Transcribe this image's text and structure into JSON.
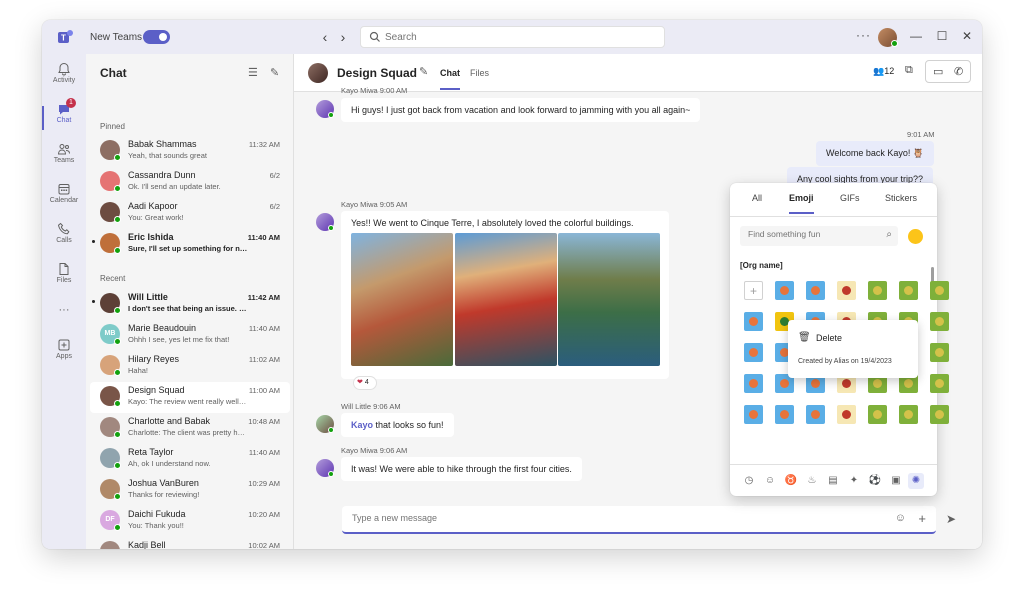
{
  "titlebar": {
    "new_teams_label": "New Teams",
    "search_placeholder": "Search",
    "back_icon": "‹",
    "forward_icon": "›",
    "more_icon": "···",
    "minimize_icon": "—",
    "maximize_icon": "☐",
    "close_icon": "✕"
  },
  "rail": {
    "items": [
      {
        "label": "Activity"
      },
      {
        "label": "Chat",
        "badge": "1"
      },
      {
        "label": "Teams"
      },
      {
        "label": "Calendar"
      },
      {
        "label": "Calls"
      },
      {
        "label": "Files"
      },
      {
        "label": "···"
      },
      {
        "label": "Apps"
      }
    ]
  },
  "chatlist": {
    "title": "Chat",
    "pinned_label": "Pinned",
    "recent_label": "Recent",
    "pinned": [
      {
        "name": "Babak Shammas",
        "preview": "Yeah, that sounds great",
        "time": "11:32 AM",
        "color": "#8d6e63"
      },
      {
        "name": "Cassandra Dunn",
        "preview": "Ok. I'll send an update later.",
        "time": "6/2",
        "color": "#e57373"
      },
      {
        "name": "Aadi Kapoor",
        "preview": "You: Great work!",
        "time": "6/2",
        "color": "#6d4c41"
      },
      {
        "name": "Eric Ishida",
        "preview": "Sure, I'll set up something for next week to...",
        "time": "11:40 AM",
        "color": "#bf6f3a"
      }
    ],
    "recent": [
      {
        "name": "Will Little",
        "preview": "I don't see that being an issue. Can you ta...",
        "time": "11:42 AM",
        "color": "#5d4037"
      },
      {
        "name": "Marie Beaudouin",
        "initials": "MB",
        "preview": "Ohhh I see, yes let me fix that!",
        "time": "11:40 AM",
        "color": "#7ecbc9"
      },
      {
        "name": "Hilary Reyes",
        "preview": "Haha!",
        "time": "11:02 AM",
        "color": "#d7a37a"
      },
      {
        "name": "Design Squad",
        "preview": "Kayo: The review went really well! Can't wai...",
        "time": "11:00 AM",
        "color": "#795548"
      },
      {
        "name": "Charlotte and Babak",
        "preview": "Charlotte: The client was pretty happy with...",
        "time": "10:48 AM",
        "color": "#a1887f"
      },
      {
        "name": "Reta Taylor",
        "preview": "Ah, ok I understand now.",
        "time": "11:40 AM",
        "color": "#90a4ae"
      },
      {
        "name": "Joshua VanBuren",
        "preview": "Thanks for reviewing!",
        "time": "10:29 AM",
        "color": "#b08968"
      },
      {
        "name": "Daichi Fukuda",
        "initials": "DF",
        "preview": "You: Thank you!!",
        "time": "10:20 AM",
        "color": "#d9a8e0"
      },
      {
        "name": "Kadji Bell",
        "preview": "You: I like the idea, let's pitch it!",
        "time": "10:02 AM",
        "color": "#a1887f"
      }
    ]
  },
  "chat": {
    "title": "Design Squad",
    "tabs": [
      "Chat",
      "Files"
    ],
    "people_count": "12",
    "messages": {
      "m0_meta": "Kayo Miwa  9:00 AM",
      "m0_text": "Hi guys! I just got back from vacation and look forward to jamming with you all again~",
      "m1_time": "9:01 AM",
      "m1_text": "Welcome back Kayo! 🦉",
      "m2_text": "Any cool sights from your trip??",
      "m3_meta": "Kayo Miwa  9:05 AM",
      "m3_text": "Yes!! We went to Cinque Terre, I absolutely loved the colorful buildings.",
      "reaction_count": "4",
      "m4_meta": "Will Little  9:06 AM",
      "m4_mention": "Kayo",
      "m4_text": " that looks so fun!",
      "m5_meta": "Kayo Miwa  9:06 AM",
      "m5_text": "It was! We were able to hike through the first four cities."
    },
    "compose_placeholder": "Type a new message"
  },
  "picker": {
    "tabs": [
      "All",
      "Emoji",
      "GIFs",
      "Stickers"
    ],
    "search_placeholder": "Find something fun",
    "org_label": "[Org name]",
    "context_menu": {
      "delete_label": "Delete",
      "created_text": "Created by Alias on 19/4/2023"
    }
  },
  "colors": {
    "accent": "#5b5fc7",
    "presence": "#13a10e",
    "badge": "#c4314b"
  }
}
